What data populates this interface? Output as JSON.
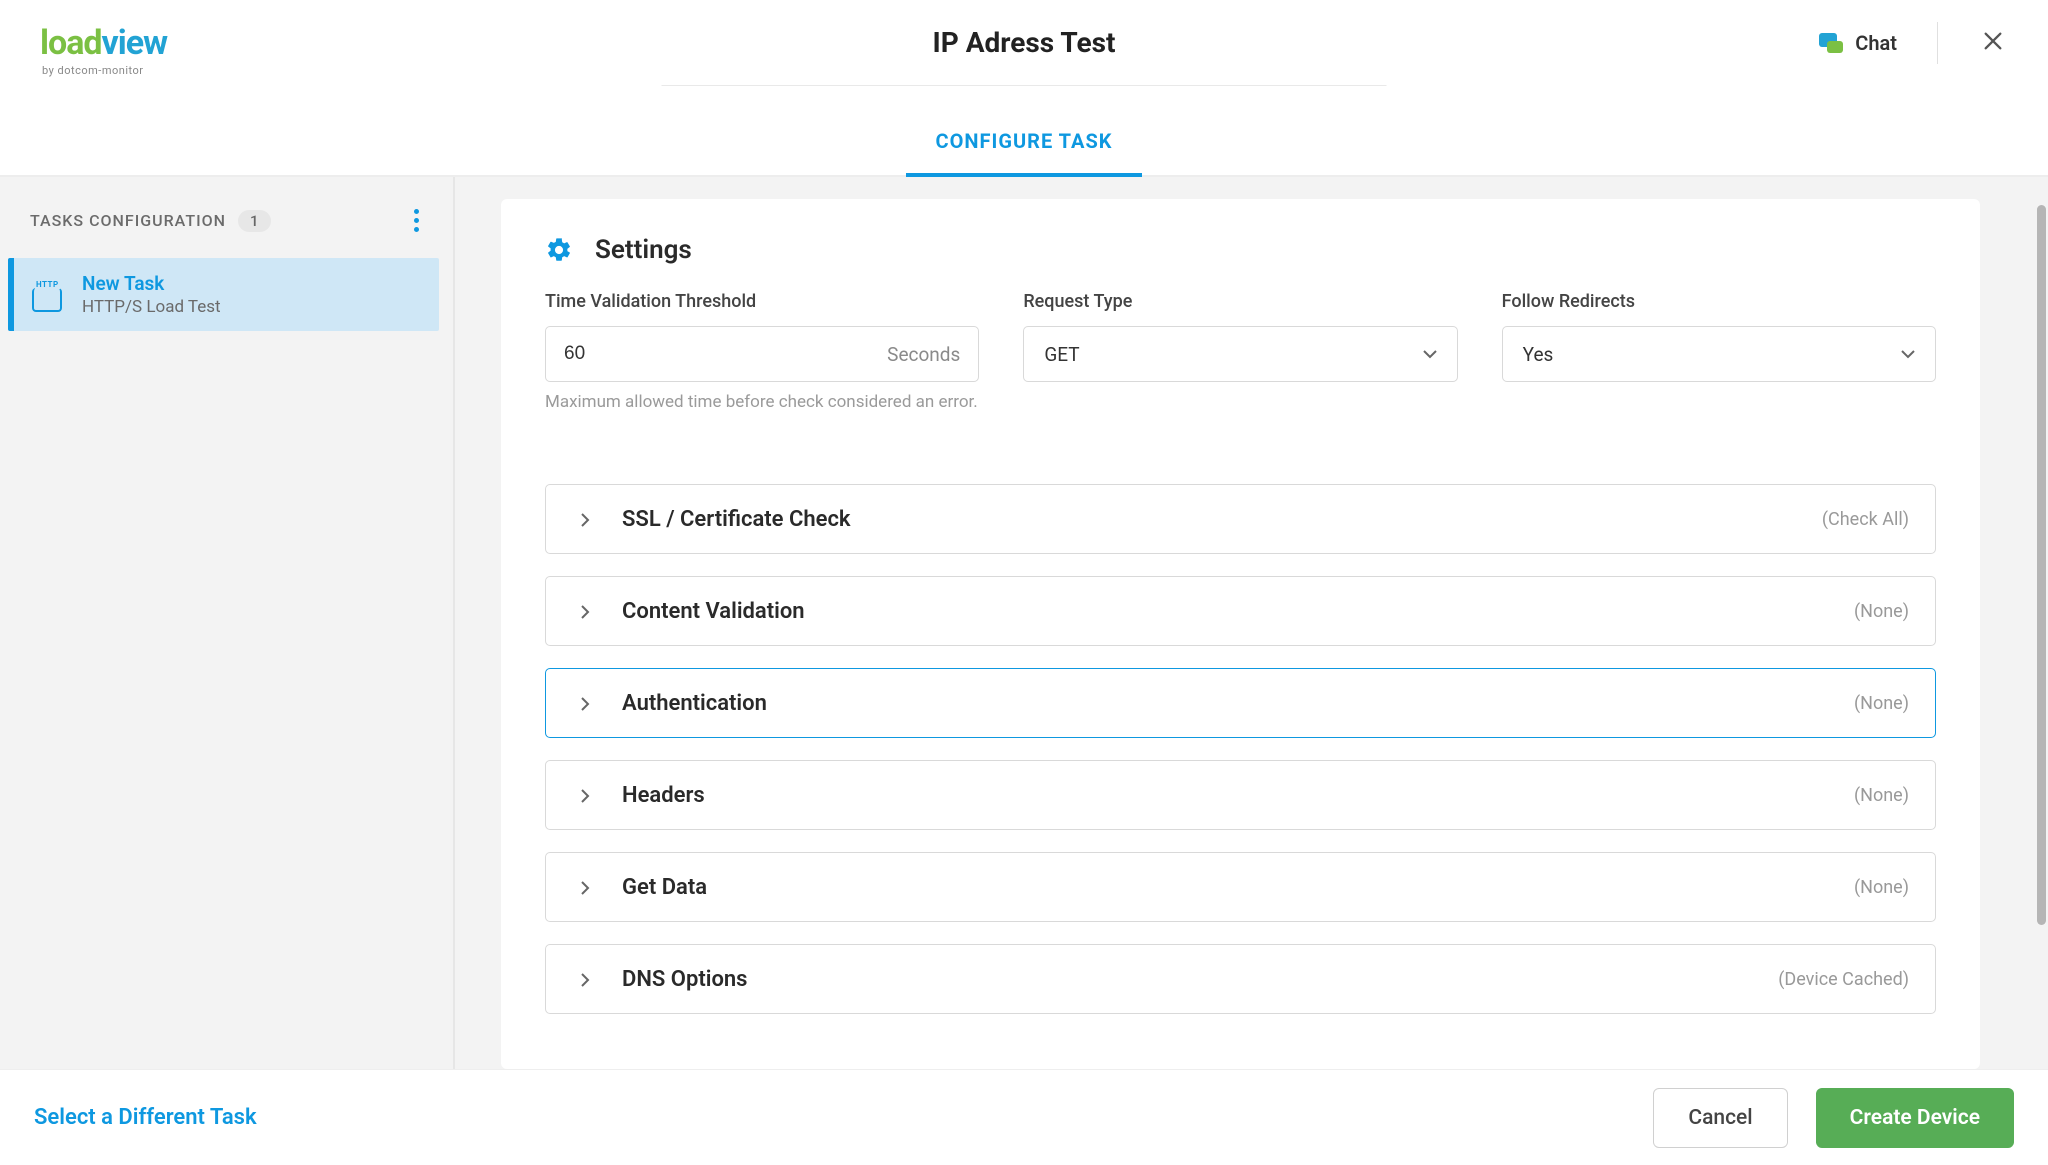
{
  "header": {
    "logo_part1": "load",
    "logo_part2": "view",
    "logo_sub": "by dotcom-monitor",
    "page_title": "IP Adress Test",
    "chat_label": "Chat"
  },
  "tabs": {
    "configure": "CONFIGURE TASK"
  },
  "sidebar": {
    "title": "TASKS CONFIGURATION",
    "count": "1",
    "task": {
      "icon_text": "HTTP",
      "name": "New Task",
      "subtitle": "HTTP/S Load Test"
    }
  },
  "panel": {
    "title": "Settings",
    "time_validation": {
      "label": "Time Validation Threshold",
      "value": "60",
      "unit": "Seconds",
      "help": "Maximum allowed time before check considered an error."
    },
    "request_type": {
      "label": "Request Type",
      "value": "GET"
    },
    "follow_redirects": {
      "label": "Follow Redirects",
      "value": "Yes"
    },
    "sections": [
      {
        "label": "SSL / Certificate Check",
        "status": "(Check All)",
        "highlighted": false
      },
      {
        "label": "Content Validation",
        "status": "(None)",
        "highlighted": false
      },
      {
        "label": "Authentication",
        "status": "(None)",
        "highlighted": true
      },
      {
        "label": "Headers",
        "status": "(None)",
        "highlighted": false
      },
      {
        "label": "Get Data",
        "status": "(None)",
        "highlighted": false
      },
      {
        "label": "DNS Options",
        "status": "(Device Cached)",
        "highlighted": false
      }
    ]
  },
  "footer": {
    "select_task": "Select a Different Task",
    "cancel": "Cancel",
    "create": "Create Device"
  }
}
